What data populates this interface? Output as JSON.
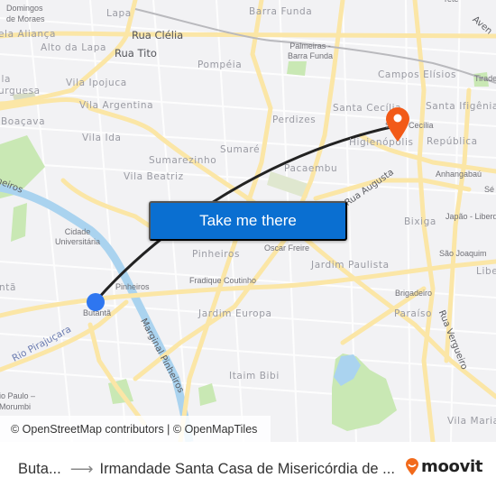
{
  "map": {
    "area_labels": [
      {
        "id": "domingos-de-moraes",
        "text": "Domingos\nde Moraes"
      },
      {
        "id": "lapa",
        "text": "Lapa"
      },
      {
        "id": "vila-alianca",
        "text": "ela Aliança"
      },
      {
        "id": "alto-da-lapa",
        "text": "Alto da Lapa"
      },
      {
        "id": "vila-burguesa",
        "text": "lla\nurguesa"
      },
      {
        "id": "vila-ipojuca",
        "text": "Vila Ipojuca"
      },
      {
        "id": "vila-argentina",
        "text": "Vila Argentina"
      },
      {
        "id": "boacava",
        "text": "Boaçava"
      },
      {
        "id": "vila-ida",
        "text": "Vila Ida"
      },
      {
        "id": "sumarezinho",
        "text": "Sumarezinho"
      },
      {
        "id": "vila-beatriz",
        "text": "Vila Beatriz"
      },
      {
        "id": "pompeia",
        "text": "Pompéia"
      },
      {
        "id": "sumare",
        "text": "Sumaré"
      },
      {
        "id": "barra-funda",
        "text": "Barra Funda"
      },
      {
        "id": "perdizes",
        "text": "Perdizes"
      },
      {
        "id": "pacaembu",
        "text": "Pacaembu"
      },
      {
        "id": "santa-cecilia",
        "text": "Santa Cecília"
      },
      {
        "id": "campos-elisios",
        "text": "Campos Elísios"
      },
      {
        "id": "santa-ifigenia",
        "text": "Santa Ifigênia"
      },
      {
        "id": "higienopolis",
        "text": "Higienópolis"
      },
      {
        "id": "republica",
        "text": "República"
      },
      {
        "id": "bixiga",
        "text": "Bixiga"
      },
      {
        "id": "pinheiros",
        "text": "Pinheiros"
      },
      {
        "id": "jardim-paulista",
        "text": "Jardim Paulista"
      },
      {
        "id": "jardim-europa",
        "text": "Jardim Europa"
      },
      {
        "id": "itaim-bibi",
        "text": "Itaim Bibi"
      },
      {
        "id": "paraiso",
        "text": "Paraíso"
      },
      {
        "id": "liberdade",
        "text": "Libe"
      },
      {
        "id": "vila-mariana",
        "text": "Vila Maria"
      },
      {
        "id": "butanta-area",
        "text": "ntã"
      }
    ],
    "station_labels": [
      {
        "id": "palmeiras-barra-funda",
        "text": "Palmeiras -\nBarra Funda"
      },
      {
        "id": "santa-cecilia-station",
        "text": "Santa Cecília"
      },
      {
        "id": "anhangabau",
        "text": "Anhangabaú"
      },
      {
        "id": "se",
        "text": "Sé"
      },
      {
        "id": "japao-liberdade",
        "text": "Japão - Liberd"
      },
      {
        "id": "sao-joaquim",
        "text": "São Joaquim"
      },
      {
        "id": "brigadeiro",
        "text": "Brigadeiro"
      },
      {
        "id": "oscar-freire",
        "text": "Oscar Freire"
      },
      {
        "id": "fradique-coutinho",
        "text": "Fradique Coutinho"
      },
      {
        "id": "pinheiros-station",
        "text": "Pinheiros"
      },
      {
        "id": "butanta-station",
        "text": "Butantã"
      },
      {
        "id": "cidade-universitaria",
        "text": "Cidade\nUniversitária"
      },
      {
        "id": "sao-paulo-morumbi",
        "text": "io Paulo –\nMorumbi"
      },
      {
        "id": "tiradentes",
        "text": "Tirade"
      }
    ],
    "street_labels": [
      {
        "id": "rua-clelia",
        "text": "Rua Clélia"
      },
      {
        "id": "rua-tito",
        "text": "Rua Tito"
      },
      {
        "id": "rua-augusta",
        "text": "Rua Augusta"
      },
      {
        "id": "rua-vergueiro",
        "text": "Rua Vergueiro"
      },
      {
        "id": "marginal-pinheiros",
        "text": "Marginal Pinheiros"
      },
      {
        "id": "marginal-pinheiros-top",
        "text": "heiros"
      },
      {
        "id": "avenida",
        "text": "Aven"
      },
      {
        "id": "frete",
        "text": "rete"
      }
    ],
    "water_labels": [
      {
        "id": "rio-pirajucara",
        "text": "Rio Pirajuçara"
      }
    ],
    "colors": {
      "land": "#f2f2f4",
      "road_major": "#fbe6a6",
      "water": "#aad3ef",
      "park": "#c9e8b4",
      "route": "#222222",
      "origin": "#2e76f0",
      "destination": "#f25a18"
    }
  },
  "cta": {
    "label": "Take me there",
    "color": "#0a6fd1"
  },
  "attribution": {
    "text": "© OpenStreetMap contributors | © OpenMapTiles"
  },
  "footer": {
    "origin": "Buta...",
    "arrow": "⟶",
    "destination": "Irmandade Santa Casa de Misericórdia de ...",
    "brand": "moovit",
    "brand_color": "#f26a1b"
  }
}
